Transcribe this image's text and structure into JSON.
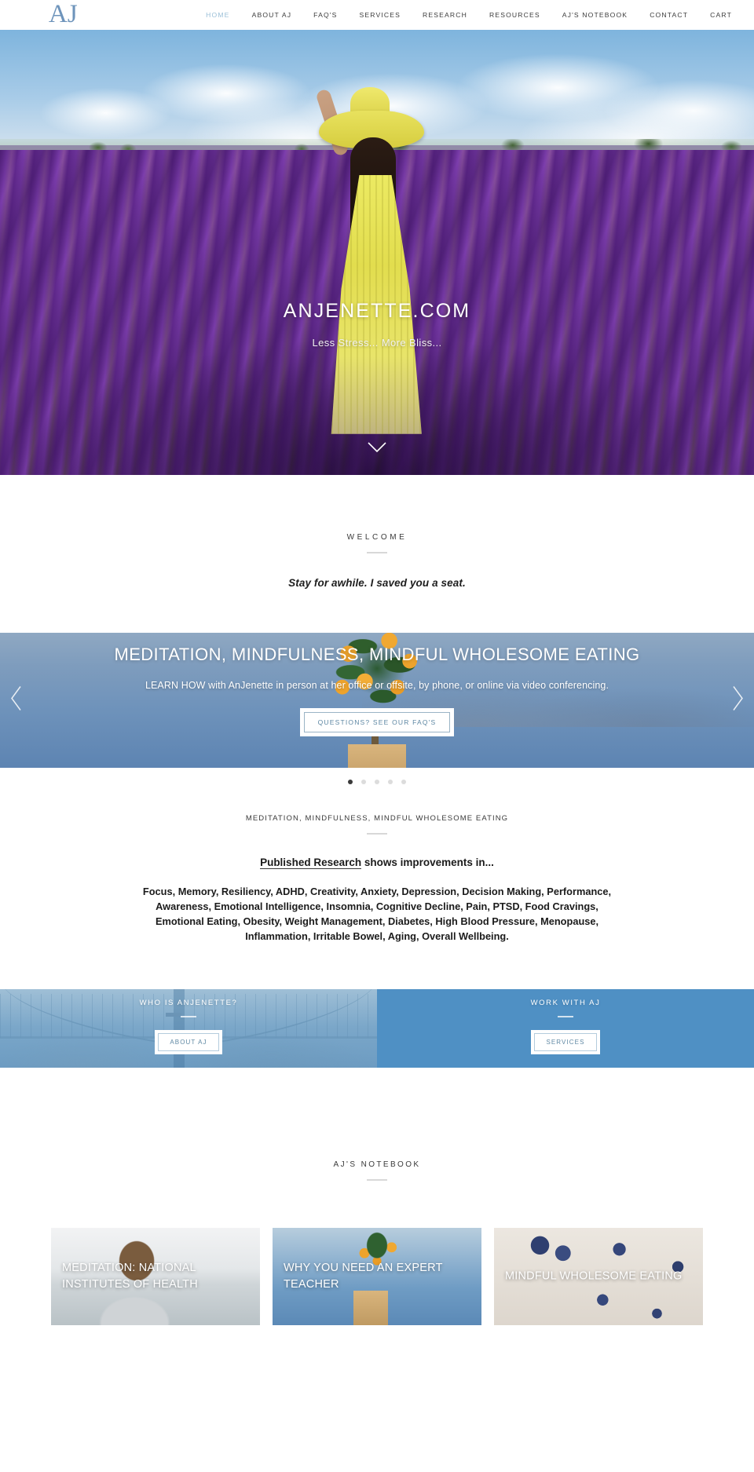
{
  "header": {
    "logo": "AJ",
    "nav": [
      {
        "label": "HOME",
        "active": true
      },
      {
        "label": "ABOUT AJ",
        "active": false
      },
      {
        "label": "FAQ'S",
        "active": false
      },
      {
        "label": "SERVICES",
        "active": false
      },
      {
        "label": "RESEARCH",
        "active": false
      },
      {
        "label": "RESOURCES",
        "active": false
      },
      {
        "label": "AJ'S NOTEBOOK",
        "active": false
      },
      {
        "label": "CONTACT",
        "active": false
      },
      {
        "label": "CART",
        "active": false
      }
    ]
  },
  "hero": {
    "title": "ANJENETTE.COM",
    "subtitle": "Less Stress... More Bliss...",
    "scroll_icon": "chevron-down-icon"
  },
  "welcome": {
    "eyebrow": "WELCOME",
    "tagline": "Stay for awhile. I saved you a seat."
  },
  "banner": {
    "title": "MEDITATION, MINDFULNESS, MINDFUL WHOLESOME EATING",
    "subtitle": "LEARN HOW with AnJenette in person at her office or offsite, by phone, or online via video conferencing.",
    "button_label": "QUESTIONS? SEE OUR FAQ'S",
    "prev_icon": "chevron-left-icon",
    "next_icon": "chevron-right-icon",
    "dots": [
      {
        "active": true
      },
      {
        "active": false
      },
      {
        "active": false
      },
      {
        "active": false
      },
      {
        "active": false
      }
    ]
  },
  "research": {
    "eyebrow": "MEDITATION, MINDFULNESS, MINDFUL WHOLESOME EATING",
    "lead": "Published Research",
    "lead_rest": " shows improvements in...",
    "list": "Focus, Memory, Resiliency, ADHD, Creativity, Anxiety, Depression, Decision Making, Performance, Awareness, Emotional Intelligence, Insomnia, Cognitive Decline, Pain, PTSD, Food Cravings, Emotional Eating, Obesity, Weight Management, Diabetes, High Blood Pressure, Menopause, Inflammation, Irritable Bowel, Aging, Overall Wellbeing."
  },
  "panels": [
    {
      "title": "WHO IS ANJENETTE?",
      "button_label": "ABOUT AJ"
    },
    {
      "title": "WORK WITH AJ",
      "button_label": "SERVICES"
    }
  ],
  "notebook": {
    "eyebrow": "AJ'S NOTEBOOK",
    "cards": [
      {
        "title": "MEDITATION: NATIONAL INSTITUTES OF HEALTH"
      },
      {
        "title": "WHY YOU NEED AN EXPERT TEACHER"
      },
      {
        "title": "MINDFUL WHOLESOME EATING"
      }
    ]
  },
  "colors": {
    "accent_blue": "#4f90c4",
    "logo_blue": "#6e94bb",
    "nav_active": "#9cc0d8",
    "button_text": "#5d87a3",
    "text_dark": "#1b1b1b"
  }
}
